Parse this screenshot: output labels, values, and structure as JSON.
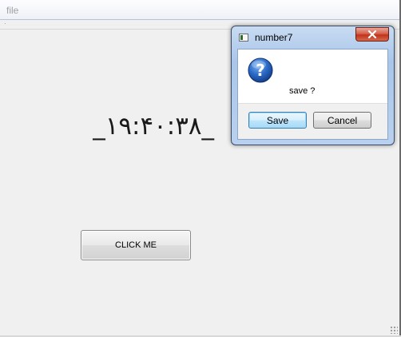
{
  "menubar": {
    "items": [
      "file"
    ]
  },
  "main": {
    "clock_text": "_۱۹:۴۰:۳۸_",
    "click_button_label": "CLICK ME"
  },
  "dialog": {
    "title": "number7",
    "message": "save ?",
    "save_label": "Save",
    "cancel_label": "Cancel",
    "icon": "question-icon",
    "close_icon": "close-icon"
  },
  "colors": {
    "background": "#f0f0f0",
    "dialog_frame": "#a9c6ea",
    "close_button": "#c0341a",
    "question_icon": "#1f5bb8"
  }
}
